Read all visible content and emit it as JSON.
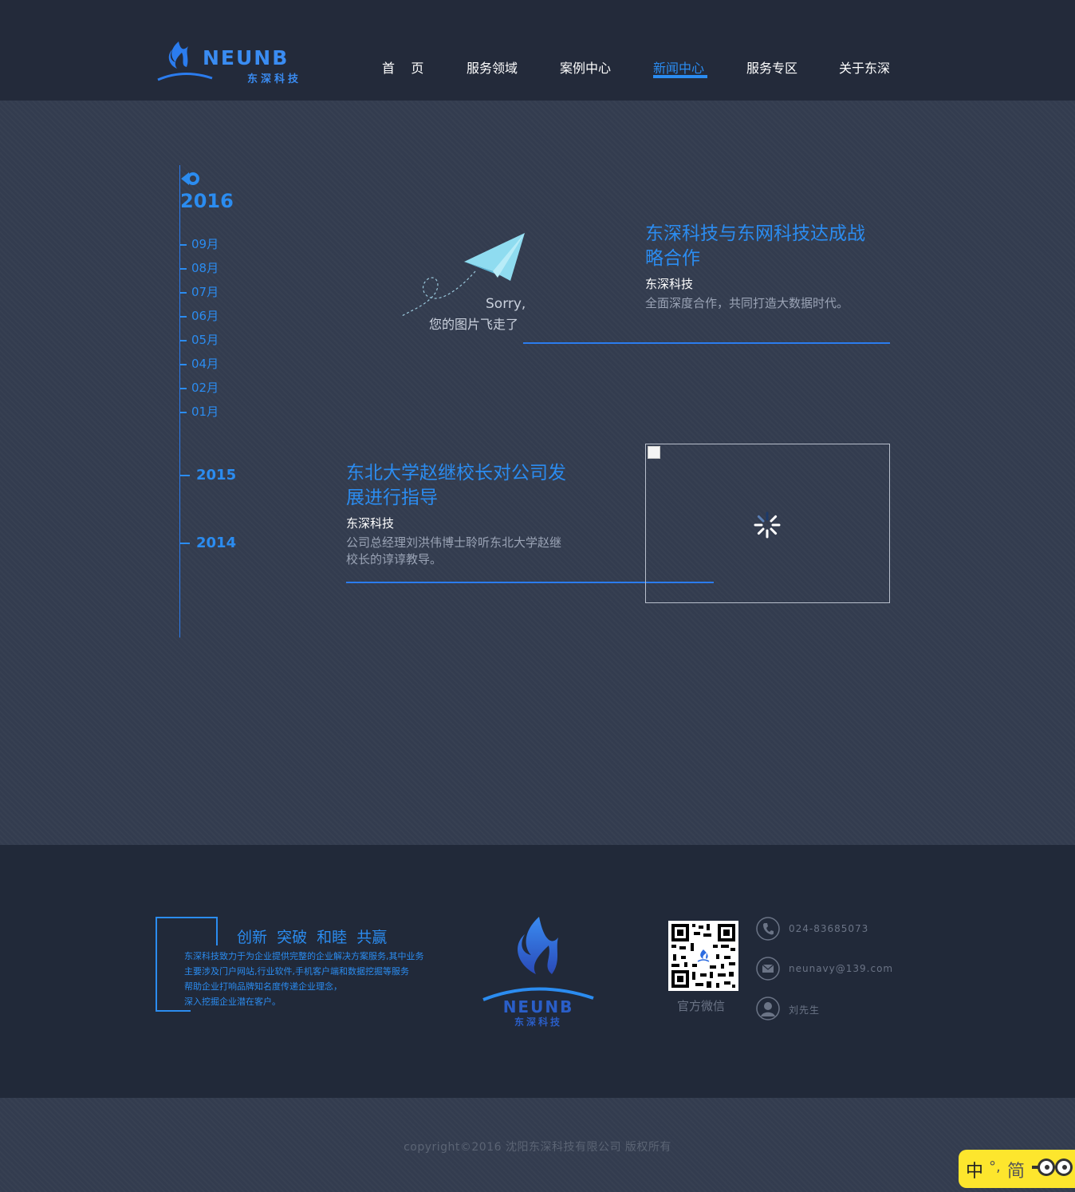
{
  "header": {
    "logo_en": "NEUNB",
    "logo_cn": "东深科技",
    "nav": [
      {
        "label": "首    页"
      },
      {
        "label": "服务领域"
      },
      {
        "label": "案例中心"
      },
      {
        "label": "新闻中心",
        "active": true
      },
      {
        "label": "服务专区"
      },
      {
        "label": "关于东深"
      }
    ]
  },
  "timeline": {
    "current_year": "2016",
    "months": [
      "09月",
      "08月",
      "07月",
      "06月",
      "05月",
      "04月",
      "02月",
      "01月"
    ],
    "other_years": [
      "2015",
      "2014"
    ]
  },
  "news": [
    {
      "title_line1": "东深科技与东网科技达成战",
      "title_line2": "略合作",
      "source": "东深科技",
      "desc_line1": "全面深度合作，共同打造大数据时代。",
      "image_placeholder": {
        "line1": "Sorry,",
        "line2": "您的图片飞走了"
      }
    },
    {
      "title_line1": "东北大学赵继校长对公司发",
      "title_line2": "展进行指导",
      "source": "东深科技",
      "desc_line1": "公司总经理刘洪伟博士聆听东北大学赵继",
      "desc_line2": "校长的谆谆教导。"
    }
  ],
  "footer": {
    "slogan": "创新  突破  和睦  共赢",
    "desc": [
      "东深科技致力于为企业提供完整的企业解决方案服务,其中业务",
      "主要涉及门户网站,行业软件,手机客户端和数据挖掘等服务",
      "帮助企业打响品牌知名度传递企业理念，",
      "深入挖掘企业潜在客户。"
    ],
    "logo_en": "NEUNB",
    "logo_cn": "东深科技",
    "qr_label": "官方微信",
    "contacts": [
      {
        "icon": "phone-icon",
        "text": "024-83685073"
      },
      {
        "icon": "mail-icon",
        "text": "neunavy@139.com"
      },
      {
        "icon": "user-icon",
        "text": "刘先生"
      }
    ],
    "copyright": "copyright©2016 沈阳东深科技有限公司 版权所有"
  },
  "ime": {
    "lang": "中",
    "punc": "°,",
    "mode": "简"
  },
  "colors": {
    "accent": "#2b8cf0",
    "header_bg": "#232a3a",
    "body_bg": "#333c4f",
    "footer_bg": "#212939"
  }
}
